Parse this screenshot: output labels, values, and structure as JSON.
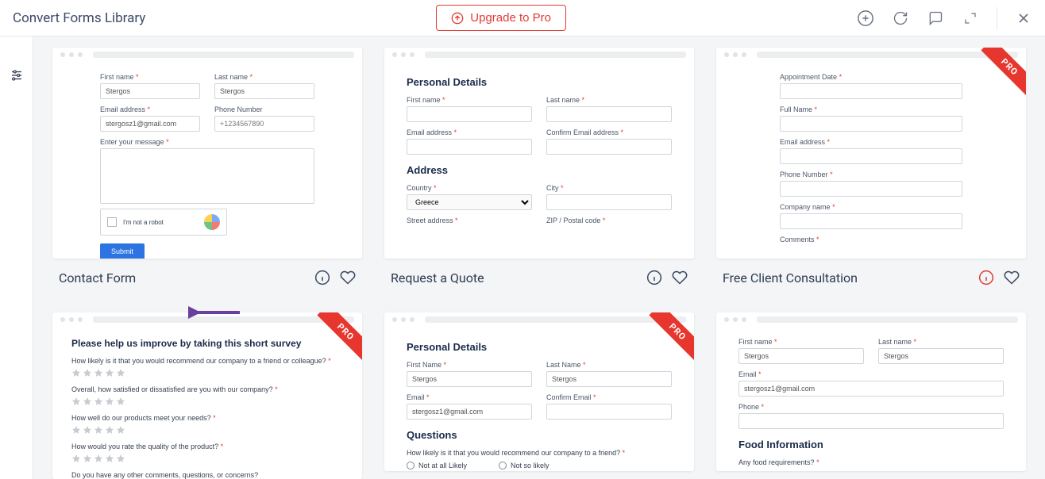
{
  "header": {
    "title": "Convert Forms Library",
    "upgrade_label": "Upgrade to Pro"
  },
  "cards": [
    {
      "title": "Contact Form",
      "pro": false,
      "info_red": false
    },
    {
      "title": "Request a Quote",
      "pro": false,
      "info_red": false
    },
    {
      "title": "Free Client Consultation",
      "pro": true,
      "info_red": true
    },
    {
      "title": "",
      "pro": true,
      "info_red": false
    },
    {
      "title": "",
      "pro": true,
      "info_red": false
    },
    {
      "title": "",
      "pro": false,
      "info_red": false
    }
  ],
  "contact_form": {
    "first_name_label": "First name",
    "first_name_value": "Stergos",
    "last_name_label": "Last name",
    "last_name_value": "Stergos",
    "email_label": "Email address",
    "email_value": "stergosz1@gmail.com",
    "phone_label": "Phone Number",
    "phone_placeholder": "+1234567890",
    "message_label": "Enter your message",
    "captcha_label": "I'm not a robot",
    "submit_label": "Submit"
  },
  "quote_form": {
    "section1": "Personal Details",
    "first_name_label": "First name",
    "last_name_label": "Last name",
    "email_label": "Email address",
    "confirm_email_label": "Confirm Email address",
    "section2": "Address",
    "country_label": "Country",
    "country_value": "Greece",
    "city_label": "City",
    "street_label": "Street address",
    "zip_label": "ZIP / Postal code"
  },
  "consultation_form": {
    "appt_label": "Appointment Date",
    "fullname_label": "Full Name",
    "email_label": "Email address",
    "phone_label": "Phone Number",
    "company_label": "Company name",
    "comments_label": "Comments"
  },
  "survey_form": {
    "title": "Please help us improve by taking this short survey",
    "q1": "How likely is it that you would recommend our company to a friend or colleague?",
    "q2": "Overall, how satisfied or dissatisfied are you with our company?",
    "q3": "How well do our products meet your needs?",
    "q4": "How would you rate the quality of the product?",
    "q5": "Do you have any other comments, questions, or concerns?"
  },
  "nps_form": {
    "section1": "Personal Details",
    "first_name_label": "First Name",
    "first_name_value": "Stergos",
    "last_name_label": "Last Name",
    "last_name_value": "Stergos",
    "email_label": "Email",
    "email_value": "stergosz1@gmail.com",
    "confirm_email_label": "Confirm Email",
    "section2": "Questions",
    "q1": "How likely is it that you would recommend our company to a friend?",
    "opt1": "Not at all Likely",
    "opt2": "Not so likely"
  },
  "food_form": {
    "first_name_label": "First name",
    "first_name_value": "Stergos",
    "last_name_label": "Last name",
    "last_name_value": "Stergos",
    "email_label": "Email",
    "email_value": "stergosz1@gmail.com",
    "phone_label": "Phone",
    "section": "Food Information",
    "q1": "Any food requirements?"
  }
}
